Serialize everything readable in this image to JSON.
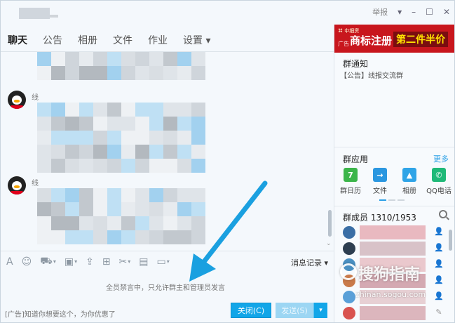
{
  "window": {
    "report_label": "举报",
    "minimize_glyph": "▾",
    "restore_glyph": "–",
    "maximize_glyph": "☐",
    "close_glyph": "✕"
  },
  "tabs": [
    {
      "label": "聊天",
      "active": true
    },
    {
      "label": "公告"
    },
    {
      "label": "相册"
    },
    {
      "label": "文件"
    },
    {
      "label": "作业"
    },
    {
      "label": "设置 ▾"
    }
  ],
  "chat": {
    "messages": [
      {
        "sender": "线"
      },
      {
        "sender": "线"
      }
    ]
  },
  "toolbar": {
    "history_label": "消息记录 ▾",
    "icons": [
      "font-icon",
      "emoji-icon",
      "gift-icon",
      "image-icon",
      "upload-icon",
      "screenshot-icon",
      "scissors-icon",
      "box-icon",
      "monitor-icon"
    ]
  },
  "mute_notice": "全员禁言中，只允许群主和管理员发言",
  "bottom": {
    "ad_text": "[广告]知道你想要这个，为你优惠了",
    "close_label": "关闭(C)",
    "send_label": "发送(S)",
    "send_dropdown": "▾"
  },
  "sidebar": {
    "ad": {
      "brand": "⌘ 中细资",
      "tag": "广告",
      "main": "商标注册",
      "promo": "第二件半价"
    },
    "notice": {
      "title": "群通知",
      "text": "【公告】线报交流群"
    },
    "apps_section": {
      "title": "群应用",
      "more": "更多",
      "apps": [
        {
          "label": "群日历",
          "color": "#3bb54a",
          "glyph": "7"
        },
        {
          "label": "文件",
          "color": "#2b97e0",
          "glyph": "→"
        },
        {
          "label": "相册",
          "color": "#2fa4e7",
          "glyph": "▲"
        },
        {
          "label": "QQ电话",
          "color": "#1fb978",
          "glyph": "✆"
        }
      ]
    },
    "members": {
      "title": "群成员 1310/1953"
    }
  },
  "watermark": {
    "text": "搜狗指南",
    "url": "zhinan.sogou.com"
  },
  "colors": {
    "accent": "#12a6e8",
    "ad_red": "#c8161d",
    "promo_yellow": "#ffe400"
  }
}
